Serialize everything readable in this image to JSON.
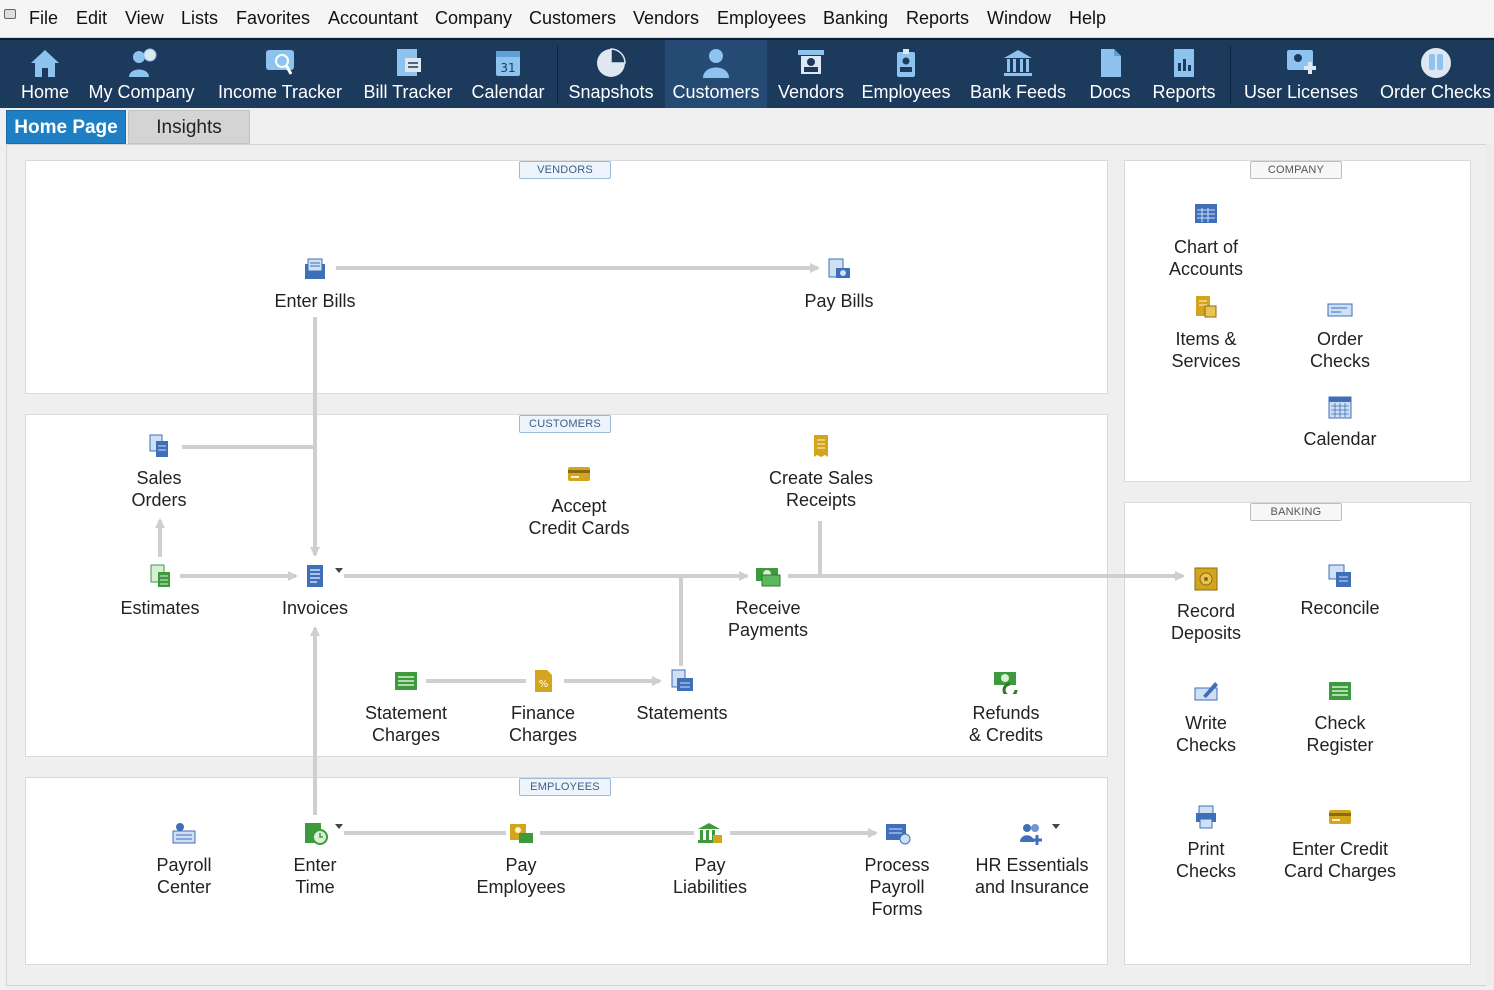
{
  "menubar": {
    "items": [
      "File",
      "Edit",
      "View",
      "Lists",
      "Favorites",
      "Accountant",
      "Company",
      "Customers",
      "Vendors",
      "Employees",
      "Banking",
      "Reports",
      "Window",
      "Help"
    ]
  },
  "toolbar": {
    "buttons": [
      {
        "label": "Home",
        "icon": "house-icon"
      },
      {
        "label": "My Company",
        "icon": "company-icon"
      },
      {
        "label": "Income Tracker",
        "icon": "income-tracker-icon"
      },
      {
        "label": "Bill Tracker",
        "icon": "bill-tracker-icon"
      },
      {
        "label": "Calendar",
        "icon": "calendar-icon"
      },
      {
        "label": "Snapshots",
        "icon": "pie-chart-icon"
      },
      {
        "label": "Customers",
        "icon": "person-icon"
      },
      {
        "label": "Vendors",
        "icon": "vendor-icon"
      },
      {
        "label": "Employees",
        "icon": "employee-badge-icon"
      },
      {
        "label": "Bank Feeds",
        "icon": "bank-icon"
      },
      {
        "label": "Docs",
        "icon": "document-icon"
      },
      {
        "label": "Reports",
        "icon": "report-icon"
      },
      {
        "label": "User Licenses",
        "icon": "user-licenses-icon"
      },
      {
        "label": "Order Checks",
        "icon": "order-checks-icon"
      }
    ],
    "active": "Customers"
  },
  "tabs": {
    "home": "Home Page",
    "insights": "Insights"
  },
  "sections": {
    "vendors": "VENDORS",
    "customers": "CUSTOMERS",
    "employees": "EMPLOYEES",
    "company": "COMPANY",
    "banking": "BANKING"
  },
  "vendors": {
    "enter_bills": "Enter Bills",
    "pay_bills": "Pay Bills"
  },
  "customers": {
    "sales_orders": "Sales\nOrders",
    "accept_credit_cards": "Accept\nCredit Cards",
    "create_sales_receipts": "Create Sales\nReceipts",
    "estimates": "Estimates",
    "invoices": "Invoices",
    "receive_payments": "Receive\nPayments",
    "statement_charges": "Statement\nCharges",
    "finance_charges": "Finance\nCharges",
    "statements": "Statements",
    "refunds_credits": "Refunds\n& Credits"
  },
  "employees": {
    "payroll_center": "Payroll\nCenter",
    "enter_time": "Enter\nTime",
    "pay_employees": "Pay\nEmployees",
    "pay_liabilities": "Pay\nLiabilities",
    "process_payroll_forms": "Process\nPayroll\nForms",
    "hr_essentials": "HR Essentials\nand Insurance"
  },
  "company": {
    "chart_of_accounts": "Chart of\nAccounts",
    "items_services": "Items &\nServices",
    "order_checks": "Order\nChecks",
    "calendar": "Calendar"
  },
  "banking": {
    "record_deposits": "Record\nDeposits",
    "reconcile": "Reconcile",
    "write_checks": "Write\nChecks",
    "check_register": "Check\nRegister",
    "print_checks": "Print\nChecks",
    "enter_credit_card_charges": "Enter Credit\nCard Charges"
  },
  "colors": {
    "toolbar_bg": "#1c3a5c",
    "toolbar_active": "#254a73",
    "tab_active": "#1f7fc4",
    "flow_arrow": "#cfcfcf",
    "icon_blue": "#3f6fb8",
    "icon_green": "#3d9a3d",
    "icon_gold": "#d3a51f"
  }
}
